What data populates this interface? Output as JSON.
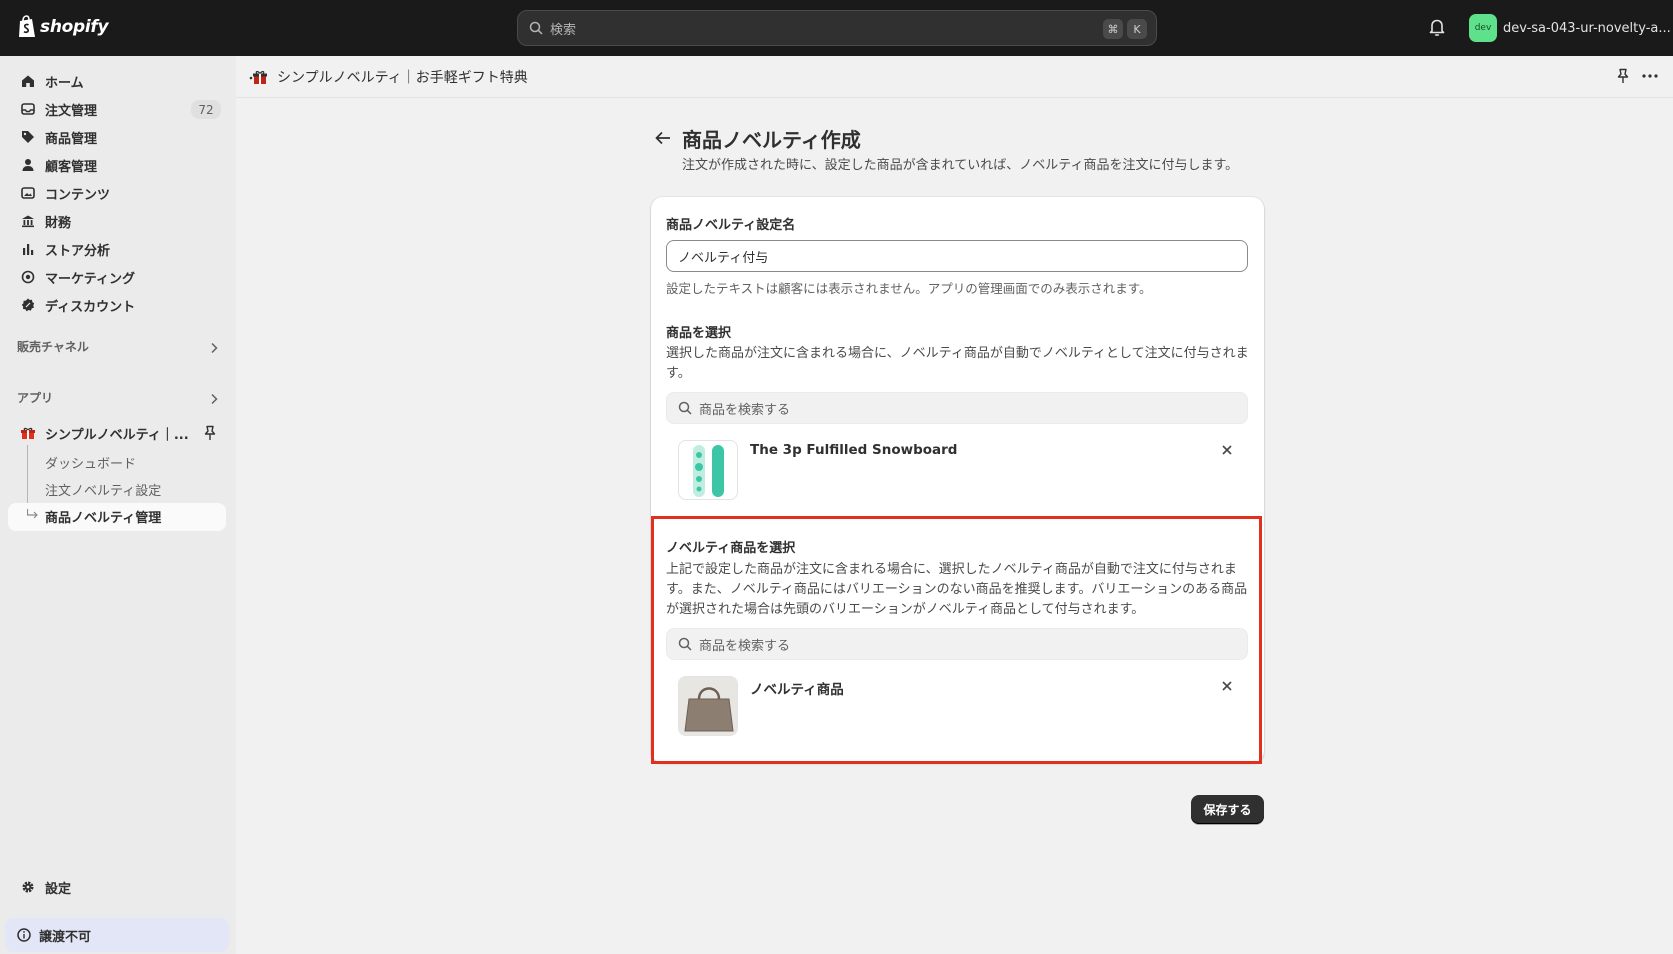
{
  "topbar": {
    "logo_text": "shopify",
    "search_placeholder": "検索",
    "shortcut_cmd": "⌘",
    "shortcut_key": "K",
    "store_avatar": "dev",
    "store_name": "dev-sa-043-ur-novelty-a..."
  },
  "sidebar": {
    "items": [
      {
        "label": "ホーム",
        "icon": "home-icon"
      },
      {
        "label": "注文管理",
        "icon": "inbox-icon",
        "badge": "72"
      },
      {
        "label": "商品管理",
        "icon": "tag-icon"
      },
      {
        "label": "顧客管理",
        "icon": "person-icon"
      },
      {
        "label": "コンテンツ",
        "icon": "image-icon"
      },
      {
        "label": "財務",
        "icon": "bank-icon"
      },
      {
        "label": "ストア分析",
        "icon": "chart-bar-icon"
      },
      {
        "label": "マーケティング",
        "icon": "target-icon"
      },
      {
        "label": "ディスカウント",
        "icon": "discount-icon"
      }
    ],
    "sales_channels": "販売チャネル",
    "apps": "アプリ",
    "app_name": "シンプルノベルティ｜...",
    "app_subitems": [
      "ダッシュボード",
      "注文ノベルティ設定",
      "商品ノベルティ管理"
    ],
    "settings": "設定",
    "notice": "譲渡不可"
  },
  "appbar": {
    "title": "シンプルノベルティ｜お手軽ギフト特典"
  },
  "page": {
    "title": "商品ノベルティ作成",
    "subtitle": "注文が作成された時に、設定した商品が含まれていれば、ノベルティ商品を注文に付与します。"
  },
  "form": {
    "name_label": "商品ノベルティ設定名",
    "name_value": "ノベルティ付与",
    "name_help": "設定したテキストは顧客には表示されません。アプリの管理画面でのみ表示されます。",
    "product_label": "商品を選択",
    "product_desc": "選択した商品が注文に含まれる場合に、ノベルティ商品が自動でノベルティとして注文に付与されます。",
    "product_search_placeholder": "商品を検索する",
    "product_selected": "The 3p Fulfilled Snowboard",
    "novelty_label": "ノベルティ商品を選択",
    "novelty_desc": "上記で設定した商品が注文に含まれる場合に、選択したノベルティ商品が自動で注文に付与されます。また、ノベルティ商品にはバリエーションのない商品を推奨します。バリエーションのある商品が選択された場合は先頭のバリエーションがノベルティ商品として付与されます。",
    "novelty_search_placeholder": "商品を検索する",
    "novelty_selected": "ノベルティ商品",
    "save": "保存する"
  },
  "colors": {
    "highlight": "#e0301e",
    "store_avatar": "#5fe08a",
    "topbar": "#1a1a1a"
  }
}
